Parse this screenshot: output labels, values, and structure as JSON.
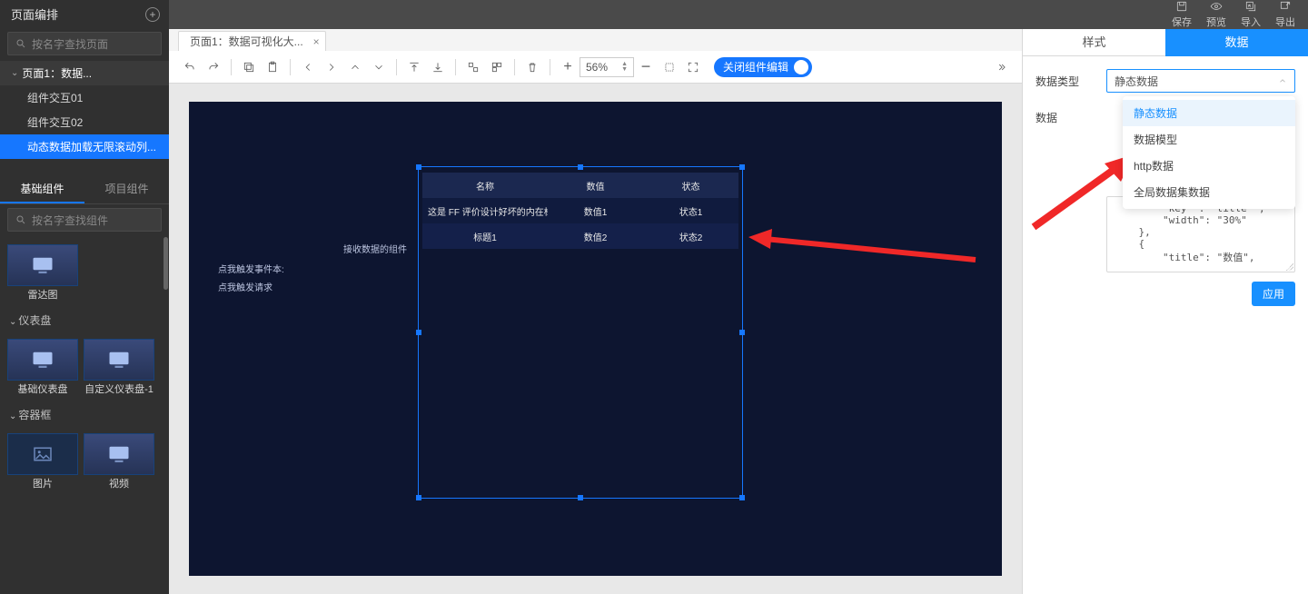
{
  "topActions": {
    "save": "保存",
    "preview": "预览",
    "import": "导入",
    "export": "导出"
  },
  "sidebar": {
    "title": "页面编排",
    "searchPlaceholder": "按名字查找页面",
    "pageNode": "页面1：数据...",
    "children": [
      {
        "label": "组件交互01"
      },
      {
        "label": "组件交互02"
      },
      {
        "label": "动态数据加载无限滚动列..."
      }
    ],
    "compTabs": {
      "basic": "基础组件",
      "project": "项目组件"
    },
    "compSearchPlaceholder": "按名字查找组件",
    "cat1": "仪表盘",
    "cat2": "容器框",
    "items": {
      "radar": "雷达图",
      "gaugeBasic": "基础仪表盘",
      "gaugeCustom": "自定义仪表盘-1",
      "image": "图片",
      "video": "视频"
    }
  },
  "centerTab": "页面1：数据可视化大...",
  "zoomValue": "56%",
  "togglePill": "关闭组件编辑",
  "canvas": {
    "t1": "接收数据的组件",
    "t2": "点我触发事件本:",
    "t3": "点我触发请求",
    "headers": [
      "名称",
      "数值",
      "状态"
    ],
    "rows": [
      [
        "这是 FF 评价设计好坏的内在标准...",
        "数值1",
        "状态1"
      ],
      [
        "标题1",
        "数值2",
        "状态2"
      ]
    ]
  },
  "right": {
    "tabStyle": "样式",
    "tabData": "数据",
    "field1Label": "数据类型",
    "field1Value": "静态数据",
    "field2Label": "数据",
    "jsonText": "        \"key\" . \"title\" ,\n        \"width\": \"30%\"\n    },\n    {\n        \"title\": \"数值\",",
    "applyBtn": "应用",
    "options": [
      "静态数据",
      "数据模型",
      "http数据",
      "全局数据集数据"
    ]
  }
}
